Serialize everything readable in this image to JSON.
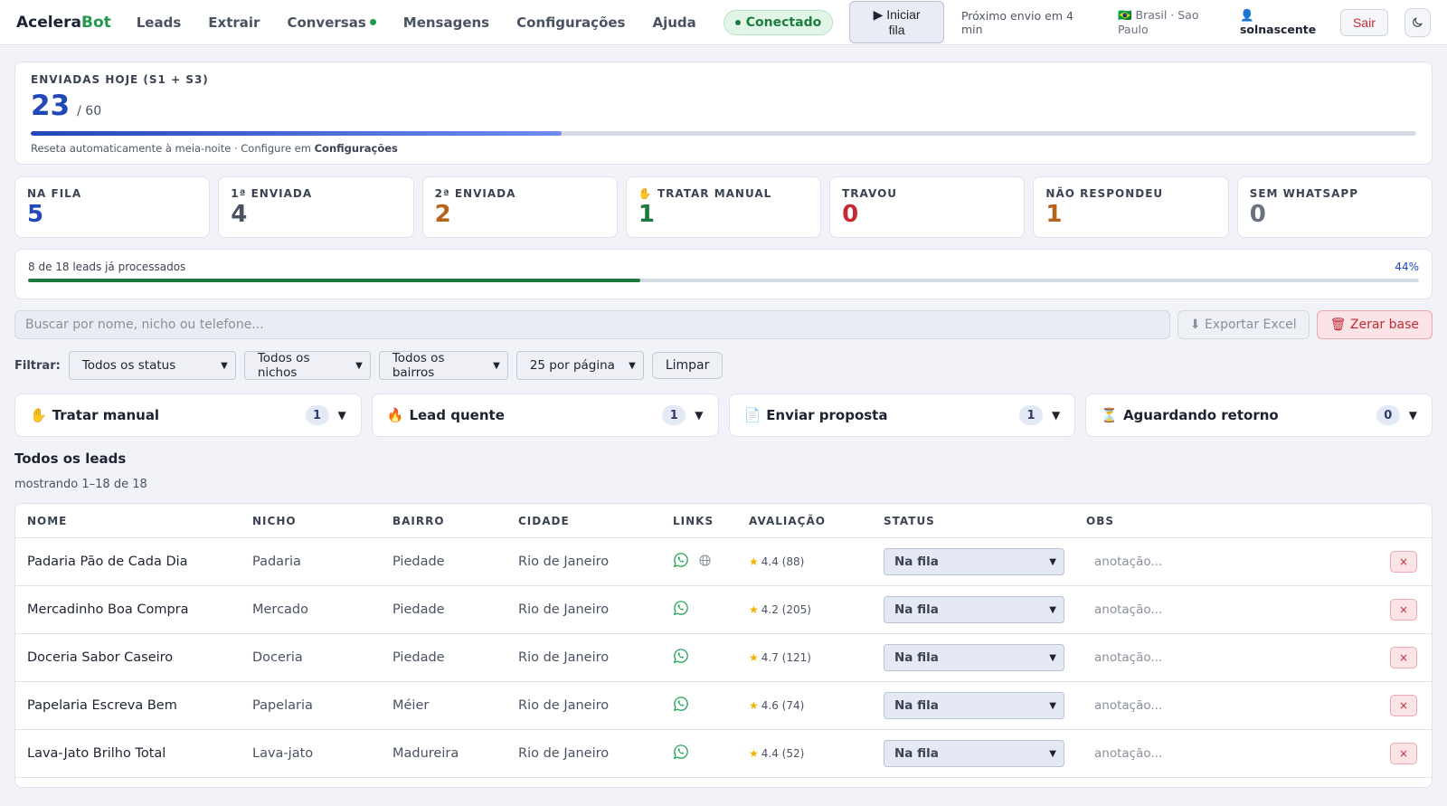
{
  "nav": {
    "brand_part1": "Acelera",
    "brand_part2": "Bot",
    "links": [
      "Leads",
      "Extrair",
      "Conversas",
      "Mensagens",
      "Configurações",
      "Ajuda"
    ],
    "status": "Conectado",
    "queue_button": "▶ Iniciar fila",
    "next_send": "Próximo envio em 4 min",
    "region": "🇧🇷 Brasil · Sao Paulo",
    "user": "solnascente",
    "logout": "Sair"
  },
  "today": {
    "label": "Enviadas hoje (S1 + S3)",
    "sent": "23",
    "limit": "/ 60",
    "progress_fraction": 0.383,
    "note_prefix": "Reseta automaticamente à meia-noite · Configure em",
    "note_link": "Configurações"
  },
  "stats": [
    {
      "label": "Na fila",
      "value": "5",
      "color": "#2247b8"
    },
    {
      "label": "1ª enviada",
      "value": "4",
      "color": "#4a5262"
    },
    {
      "label": "2ª enviada",
      "value": "2",
      "color": "#b3631a"
    },
    {
      "label": "✋ Tratar manual",
      "value": "1",
      "color": "#1b7a3c"
    },
    {
      "label": "Travou",
      "value": "0",
      "color": "#c22b36"
    },
    {
      "label": "Não respondeu",
      "value": "1",
      "color": "#b3631a"
    },
    {
      "label": "Sem WhatsApp",
      "value": "0",
      "color": "#6a7180"
    }
  ],
  "progress": {
    "text": "8 de 18 leads já processados",
    "percent": "44%",
    "fraction": 0.44
  },
  "search": {
    "placeholder": "Buscar por nome, nicho ou telefone...",
    "export_label": "⬇ Exportar Excel",
    "reset_label": "🗑 Zerar base"
  },
  "filters": {
    "label": "Filtrar:",
    "status": "Todos os status",
    "niche": "Todos os nichos",
    "district": "Todos os bairros",
    "per_page": "25 por página",
    "clear": "Limpar"
  },
  "groups": [
    {
      "icon": "✋",
      "name": "Tratar manual",
      "count": "1"
    },
    {
      "icon": "🔥",
      "name": "Lead quente",
      "count": "1"
    },
    {
      "icon": "📄",
      "name": "Enviar proposta",
      "count": "1"
    },
    {
      "icon": "⏳",
      "name": "Aguardando retorno",
      "count": "0"
    }
  ],
  "leads_section": {
    "title": "Todos os leads",
    "subtitle": "mostrando 1–18 de 18"
  },
  "table": {
    "headers": [
      "Nome",
      "Nicho",
      "Bairro",
      "Cidade",
      "Links",
      "Avaliação",
      "Status",
      "Obs"
    ],
    "obs_placeholder": "anotação...",
    "delete_label": "×",
    "rows": [
      {
        "name": "Padaria Pão de Cada Dia",
        "niche": "Padaria",
        "district": "Piedade",
        "city": "Rio de Janeiro",
        "rating": "4.4 (88)",
        "status": "Na fila",
        "has_site": true
      },
      {
        "name": "Mercadinho Boa Compra",
        "niche": "Mercado",
        "district": "Piedade",
        "city": "Rio de Janeiro",
        "rating": "4.2 (205)",
        "status": "Na fila",
        "has_site": false
      },
      {
        "name": "Doceria Sabor Caseiro",
        "niche": "Doceria",
        "district": "Piedade",
        "city": "Rio de Janeiro",
        "rating": "4.7 (121)",
        "status": "Na fila",
        "has_site": false
      },
      {
        "name": "Papelaria Escreva Bem",
        "niche": "Papelaria",
        "district": "Méier",
        "city": "Rio de Janeiro",
        "rating": "4.6 (74)",
        "status": "Na fila",
        "has_site": false
      },
      {
        "name": "Lava-Jato Brilho Total",
        "niche": "Lava-jato",
        "district": "Madureira",
        "city": "Rio de Janeiro",
        "rating": "4.4 (52)",
        "status": "Na fila",
        "has_site": false
      }
    ]
  }
}
